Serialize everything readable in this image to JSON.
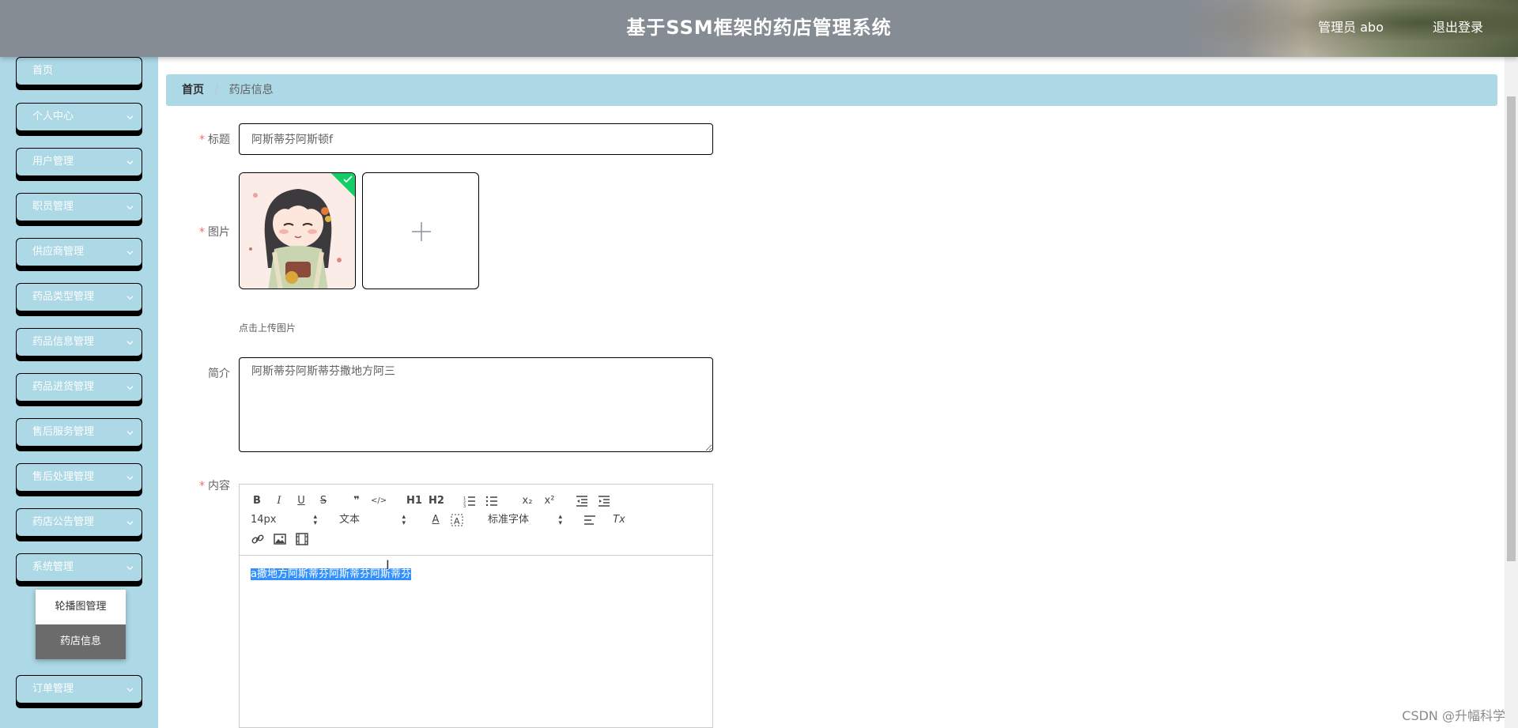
{
  "header": {
    "title": "基于SSM框架的药店管理系统",
    "user": "管理员 abo",
    "logout": "退出登录"
  },
  "sidebar": {
    "items": [
      {
        "label": "首页"
      },
      {
        "label": "个人中心"
      },
      {
        "label": "用户管理"
      },
      {
        "label": "职员管理"
      },
      {
        "label": "供应商管理"
      },
      {
        "label": "药品类型管理"
      },
      {
        "label": "药品信息管理"
      },
      {
        "label": "药品进货管理"
      },
      {
        "label": "售后服务管理"
      },
      {
        "label": "售后处理管理"
      },
      {
        "label": "药店公告管理"
      },
      {
        "label": "系统管理"
      },
      {
        "label": "订单管理"
      }
    ],
    "submenu": [
      {
        "label": "轮播图管理"
      },
      {
        "label": "药店信息",
        "active": true
      }
    ]
  },
  "breadcrumb": {
    "home": "首页",
    "separator": "/",
    "current": "药店信息"
  },
  "form": {
    "title_label": "标题",
    "title_value": "阿斯蒂芬阿斯顿f",
    "image_label": "图片",
    "upload_hint": "点击上传图片",
    "intro_label": "简介",
    "intro_value": "阿斯蒂芬阿斯蒂芬撒地方阿三",
    "content_label": "内容",
    "required_mark": "*"
  },
  "editor": {
    "toolbar": {
      "bold": "B",
      "italic": "I",
      "underline": "U",
      "strike": "S",
      "quote": "❞",
      "code": "</>",
      "h1": "H1",
      "h2": "H2",
      "sub": "x₂",
      "sup": "x²",
      "size": "14px",
      "header_select": "文本",
      "font_select": "标准字体",
      "font_color": "A",
      "clear": "Tx"
    },
    "content": "a撒地方阿斯蒂芬阿斯蒂芬阿斯蒂芬"
  },
  "colors": {
    "sidebar_bg": "#add8e6",
    "header_bg": "#858c94",
    "upload_success": "#13ce66",
    "selection": "#3390ff"
  },
  "watermark": "CSDN @升幅科学"
}
